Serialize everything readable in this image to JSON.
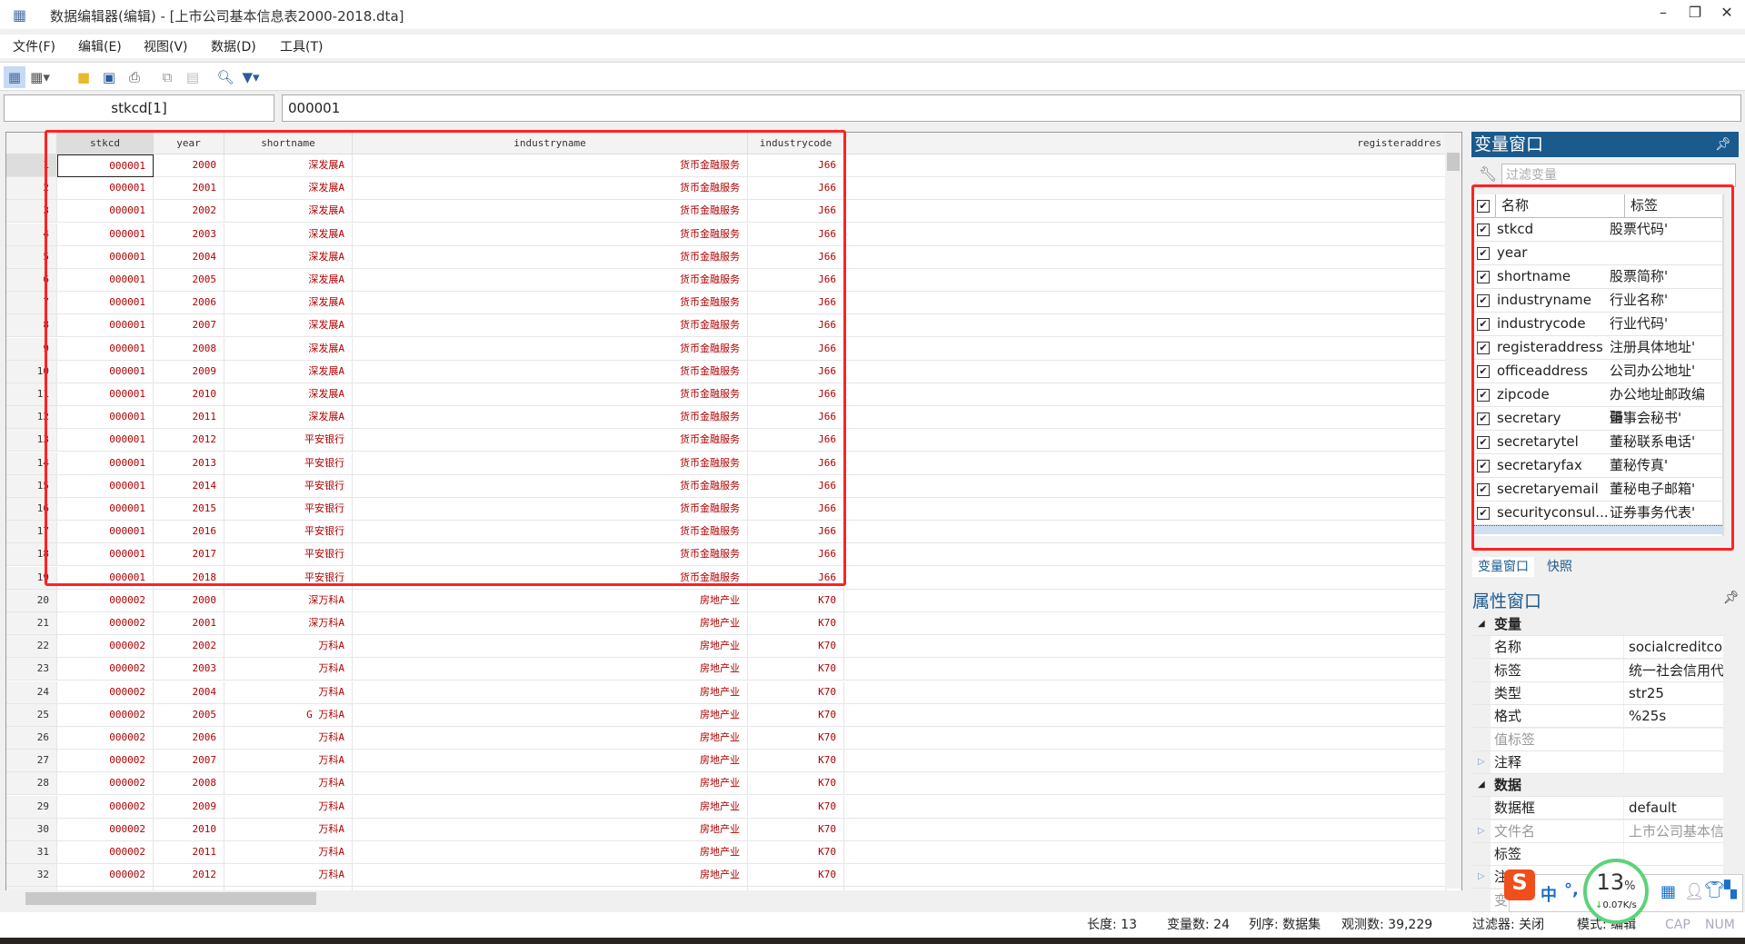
{
  "window": {
    "title": "数据编辑器(编辑) - [上市公司基本信息表2000-2018.dta]",
    "minimize": "–",
    "restore": "❐",
    "close": "✕"
  },
  "menu": [
    "文件(F)",
    "编辑(E)",
    "视图(V)",
    "数据(D)",
    "工具(T)"
  ],
  "toolbar": {
    "icons": [
      "edit-mode-icon",
      "browse-mode-icon",
      "open-folder-icon",
      "save-icon",
      "print-icon",
      "copy-icon",
      "paste-icon",
      "search-icon",
      "filter-icon"
    ]
  },
  "cellbar": {
    "name": "stkcd[1]",
    "value": "000001"
  },
  "grid": {
    "columns": [
      "stkcd",
      "year",
      "shortname",
      "industryname",
      "industrycode",
      "registeraddres"
    ],
    "rows": [
      [
        "1",
        "000001",
        "2000",
        "深发展A",
        "货币金融服务",
        "J66"
      ],
      [
        "2",
        "000001",
        "2001",
        "深发展A",
        "货币金融服务",
        "J66"
      ],
      [
        "3",
        "000001",
        "2002",
        "深发展A",
        "货币金融服务",
        "J66"
      ],
      [
        "4",
        "000001",
        "2003",
        "深发展A",
        "货币金融服务",
        "J66"
      ],
      [
        "5",
        "000001",
        "2004",
        "深发展A",
        "货币金融服务",
        "J66"
      ],
      [
        "6",
        "000001",
        "2005",
        "深发展A",
        "货币金融服务",
        "J66"
      ],
      [
        "7",
        "000001",
        "2006",
        "深发展A",
        "货币金融服务",
        "J66"
      ],
      [
        "8",
        "000001",
        "2007",
        "深发展A",
        "货币金融服务",
        "J66"
      ],
      [
        "9",
        "000001",
        "2008",
        "深发展A",
        "货币金融服务",
        "J66"
      ],
      [
        "10",
        "000001",
        "2009",
        "深发展A",
        "货币金融服务",
        "J66"
      ],
      [
        "11",
        "000001",
        "2010",
        "深发展A",
        "货币金融服务",
        "J66"
      ],
      [
        "12",
        "000001",
        "2011",
        "深发展A",
        "货币金融服务",
        "J66"
      ],
      [
        "13",
        "000001",
        "2012",
        "平安银行",
        "货币金融服务",
        "J66"
      ],
      [
        "14",
        "000001",
        "2013",
        "平安银行",
        "货币金融服务",
        "J66"
      ],
      [
        "15",
        "000001",
        "2014",
        "平安银行",
        "货币金融服务",
        "J66"
      ],
      [
        "16",
        "000001",
        "2015",
        "平安银行",
        "货币金融服务",
        "J66"
      ],
      [
        "17",
        "000001",
        "2016",
        "平安银行",
        "货币金融服务",
        "J66"
      ],
      [
        "18",
        "000001",
        "2017",
        "平安银行",
        "货币金融服务",
        "J66"
      ],
      [
        "19",
        "000001",
        "2018",
        "平安银行",
        "货币金融服务",
        "J66"
      ],
      [
        "20",
        "000002",
        "2000",
        "深万科A",
        "房地产业",
        "K70"
      ],
      [
        "21",
        "000002",
        "2001",
        "深万科A",
        "房地产业",
        "K70"
      ],
      [
        "22",
        "000002",
        "2002",
        "万科A",
        "房地产业",
        "K70"
      ],
      [
        "23",
        "000002",
        "2003",
        "万科A",
        "房地产业",
        "K70"
      ],
      [
        "24",
        "000002",
        "2004",
        "万科A",
        "房地产业",
        "K70"
      ],
      [
        "25",
        "000002",
        "2005",
        "G 万科A",
        "房地产业",
        "K70"
      ],
      [
        "26",
        "000002",
        "2006",
        "万科A",
        "房地产业",
        "K70"
      ],
      [
        "27",
        "000002",
        "2007",
        "万科A",
        "房地产业",
        "K70"
      ],
      [
        "28",
        "000002",
        "2008",
        "万科A",
        "房地产业",
        "K70"
      ],
      [
        "29",
        "000002",
        "2009",
        "万科A",
        "房地产业",
        "K70"
      ],
      [
        "30",
        "000002",
        "2010",
        "万科A",
        "房地产业",
        "K70"
      ],
      [
        "31",
        "000002",
        "2011",
        "万科A",
        "房地产业",
        "K70"
      ],
      [
        "32",
        "000002",
        "2012",
        "万科A",
        "房地产业",
        "K70"
      ]
    ]
  },
  "variables_window": {
    "title": "变量窗口",
    "filter_placeholder": "过滤变量",
    "col_name": "名称",
    "col_label": "标签",
    "items": [
      [
        "stkcd",
        "股票代码'"
      ],
      [
        "year",
        ""
      ],
      [
        "shortname",
        "股票简称'"
      ],
      [
        "industryname",
        "行业名称'"
      ],
      [
        "industrycode",
        "行业代码'"
      ],
      [
        "registeraddress",
        "注册具体地址'"
      ],
      [
        "officeaddress",
        "公司办公地址'"
      ],
      [
        "zipcode",
        "办公地址邮政编码'"
      ],
      [
        "secretary",
        "董事会秘书'"
      ],
      [
        "secretarytel",
        "董秘联系电话'"
      ],
      [
        "secretaryfax",
        "董秘传真'"
      ],
      [
        "secretaryemail",
        "董秘电子邮箱'"
      ],
      [
        "securityconsul...",
        "证券事务代表'"
      ]
    ],
    "tabs": [
      "变量窗口",
      "快照"
    ]
  },
  "properties_window": {
    "title": "属性窗口",
    "rows": [
      [
        "group",
        "变量",
        ""
      ],
      [
        "prop",
        "名称",
        "socialcreditcode"
      ],
      [
        "prop",
        "标签",
        "统一社会信用代码"
      ],
      [
        "prop",
        "类型",
        "str25"
      ],
      [
        "prop",
        "格式",
        "%25s"
      ],
      [
        "propdim",
        "值标签",
        ""
      ],
      [
        "propx",
        "注释",
        ""
      ],
      [
        "group",
        "数据",
        ""
      ],
      [
        "prop",
        "数据框",
        "default"
      ],
      [
        "propxdim",
        "文件名",
        "上市公司基本信息表"
      ],
      [
        "prop",
        "标签",
        ""
      ],
      [
        "propx",
        "注释",
        ""
      ],
      [
        "propdim",
        "变",
        ""
      ]
    ]
  },
  "status": {
    "length": "长度: 13",
    "vars": "变量数: 24",
    "order": "列序: 数据集",
    "obs": "观测数: 39,229",
    "filter": "过滤器: 关闭",
    "mode": "模式: 编辑",
    "cap": "CAP",
    "num": "NUM"
  },
  "overlay": {
    "percent": "13",
    "percent_sign": "%",
    "speed": "0.07K/s",
    "ime_lang": "中",
    "ime_punct": "°,"
  },
  "colors": {
    "accent": "#1b5a8c",
    "cell_text": "#b00000",
    "highlight": "#ff2222"
  }
}
